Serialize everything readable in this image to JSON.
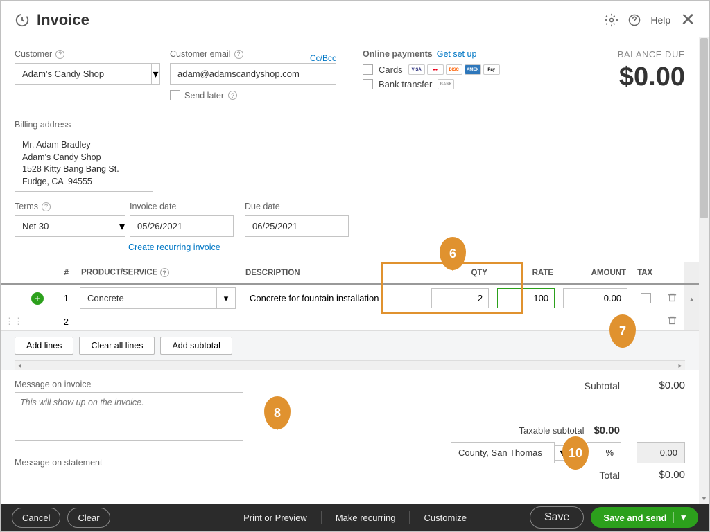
{
  "header": {
    "title": "Invoice",
    "help": "Help"
  },
  "customer": {
    "label": "Customer",
    "value": "Adam's Candy Shop",
    "email_label": "Customer email",
    "email_value": "adam@adamscandyshop.com",
    "ccbcc": "Cc/Bcc",
    "send_later": "Send later"
  },
  "online_payments": {
    "title": "Online payments",
    "setup": "Get set up",
    "cards": "Cards",
    "bank": "Bank transfer"
  },
  "balance": {
    "label": "BALANCE DUE",
    "amount": "$0.00"
  },
  "billing": {
    "label": "Billing address",
    "value": "Mr. Adam Bradley\nAdam's Candy Shop\n1528 Kitty Bang Bang St.\nFudge, CA  94555"
  },
  "terms": {
    "label": "Terms",
    "value": "Net 30"
  },
  "invoice_date": {
    "label": "Invoice date",
    "value": "05/26/2021"
  },
  "due_date": {
    "label": "Due date",
    "value": "06/25/2021"
  },
  "create_recurring": "Create recurring invoice",
  "grid": {
    "headers": {
      "num": "#",
      "product": "PRODUCT/SERVICE",
      "description": "DESCRIPTION",
      "qty": "QTY",
      "rate": "RATE",
      "amount": "AMOUNT",
      "tax": "TAX"
    },
    "rows": [
      {
        "num": "1",
        "product": "Concrete",
        "description": "Concrete for fountain installation",
        "qty": "2",
        "rate": "100",
        "amount": "0.00"
      },
      {
        "num": "2",
        "product": "",
        "description": "",
        "qty": "",
        "rate": "",
        "amount": ""
      }
    ],
    "buttons": {
      "add_lines": "Add lines",
      "clear_all": "Clear all lines",
      "add_subtotal": "Add subtotal"
    }
  },
  "messages": {
    "invoice_label": "Message on invoice",
    "invoice_placeholder": "This will show up on the invoice.",
    "statement_label": "Message on statement"
  },
  "totals": {
    "subtotal_label": "Subtotal",
    "subtotal_val": "$0.00",
    "taxable_label": "Taxable subtotal",
    "taxable_val": "$0.00",
    "tax_jurisdiction": "County, San Thomas",
    "tax_pct": "%",
    "tax_amt": "0.00",
    "total_label": "Total",
    "total_val": "$0.00"
  },
  "footer": {
    "cancel": "Cancel",
    "clear": "Clear",
    "print": "Print or Preview",
    "recurring": "Make recurring",
    "customize": "Customize",
    "save": "Save",
    "save_send": "Save and send"
  },
  "callouts": {
    "c6": "6",
    "c7": "7",
    "c8": "8",
    "c10": "10"
  }
}
